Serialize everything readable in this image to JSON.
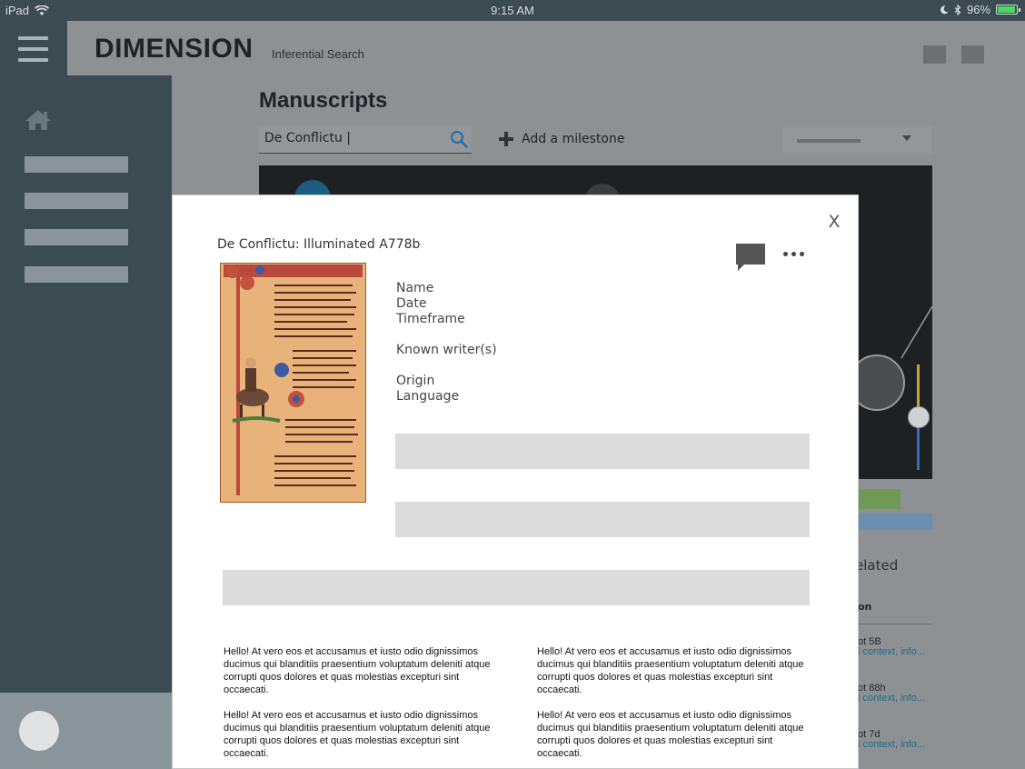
{
  "status_bar": {
    "device": "iPad",
    "time": "9:15 AM",
    "battery": "96%",
    "battery_level": 0.96
  },
  "header": {
    "brand": "DIMENSION",
    "subtitle": "Inferential Search"
  },
  "page": {
    "title": "Manuscripts"
  },
  "search": {
    "value": "De Conflictu |"
  },
  "toolbar": {
    "add_milestone_label": "Add a milestone"
  },
  "related": {
    "label_partial": "elated",
    "column_header_partial": "on",
    "items": [
      {
        "title": "ot 5B",
        "context": "l context, info..."
      },
      {
        "title": "ot 88h",
        "context": "l context, info..."
      },
      {
        "title": "ot 7d",
        "context": "l context, info..."
      }
    ]
  },
  "modal": {
    "close_label": "X",
    "title": "De Conflictu: Illuminated A778b",
    "fields": {
      "name": "Name",
      "date": "Date",
      "timeframe": "Timeframe",
      "writers": "Known writer(s)",
      "origin": "Origin",
      "language": "Language"
    },
    "paragraphs": {
      "left_1": "Hello! At vero eos et accusamus et iusto odio dignissimos ducimus qui blanditiis praesentium voluptatum deleniti atque corrupti quos dolores et quas molestias excepturi sint occaecati.",
      "left_2": "Hello! At vero eos et accusamus et iusto odio dignissimos ducimus qui blanditiis praesentium voluptatum deleniti atque corrupti quos dolores et quas molestias excepturi sint occaecati.",
      "right_1": "Hello! At vero eos et accusamus et iusto odio dignissimos ducimus qui blanditiis praesentium voluptatum deleniti atque corrupti quos dolores et quas molestias excepturi sint occaecati.",
      "right_2": "Hello! At vero eos et accusamus et iusto odio dignissimos ducimus qui blanditiis praesentium voluptatum deleniti atque corrupti quos dolores et quas molestias excepturi sint occaecati."
    }
  },
  "colors": {
    "sidebar": "#3c4a52",
    "overlay_gray": "#8e9194",
    "placeholder": "#dcdcdc",
    "link": "#1a6c86"
  }
}
